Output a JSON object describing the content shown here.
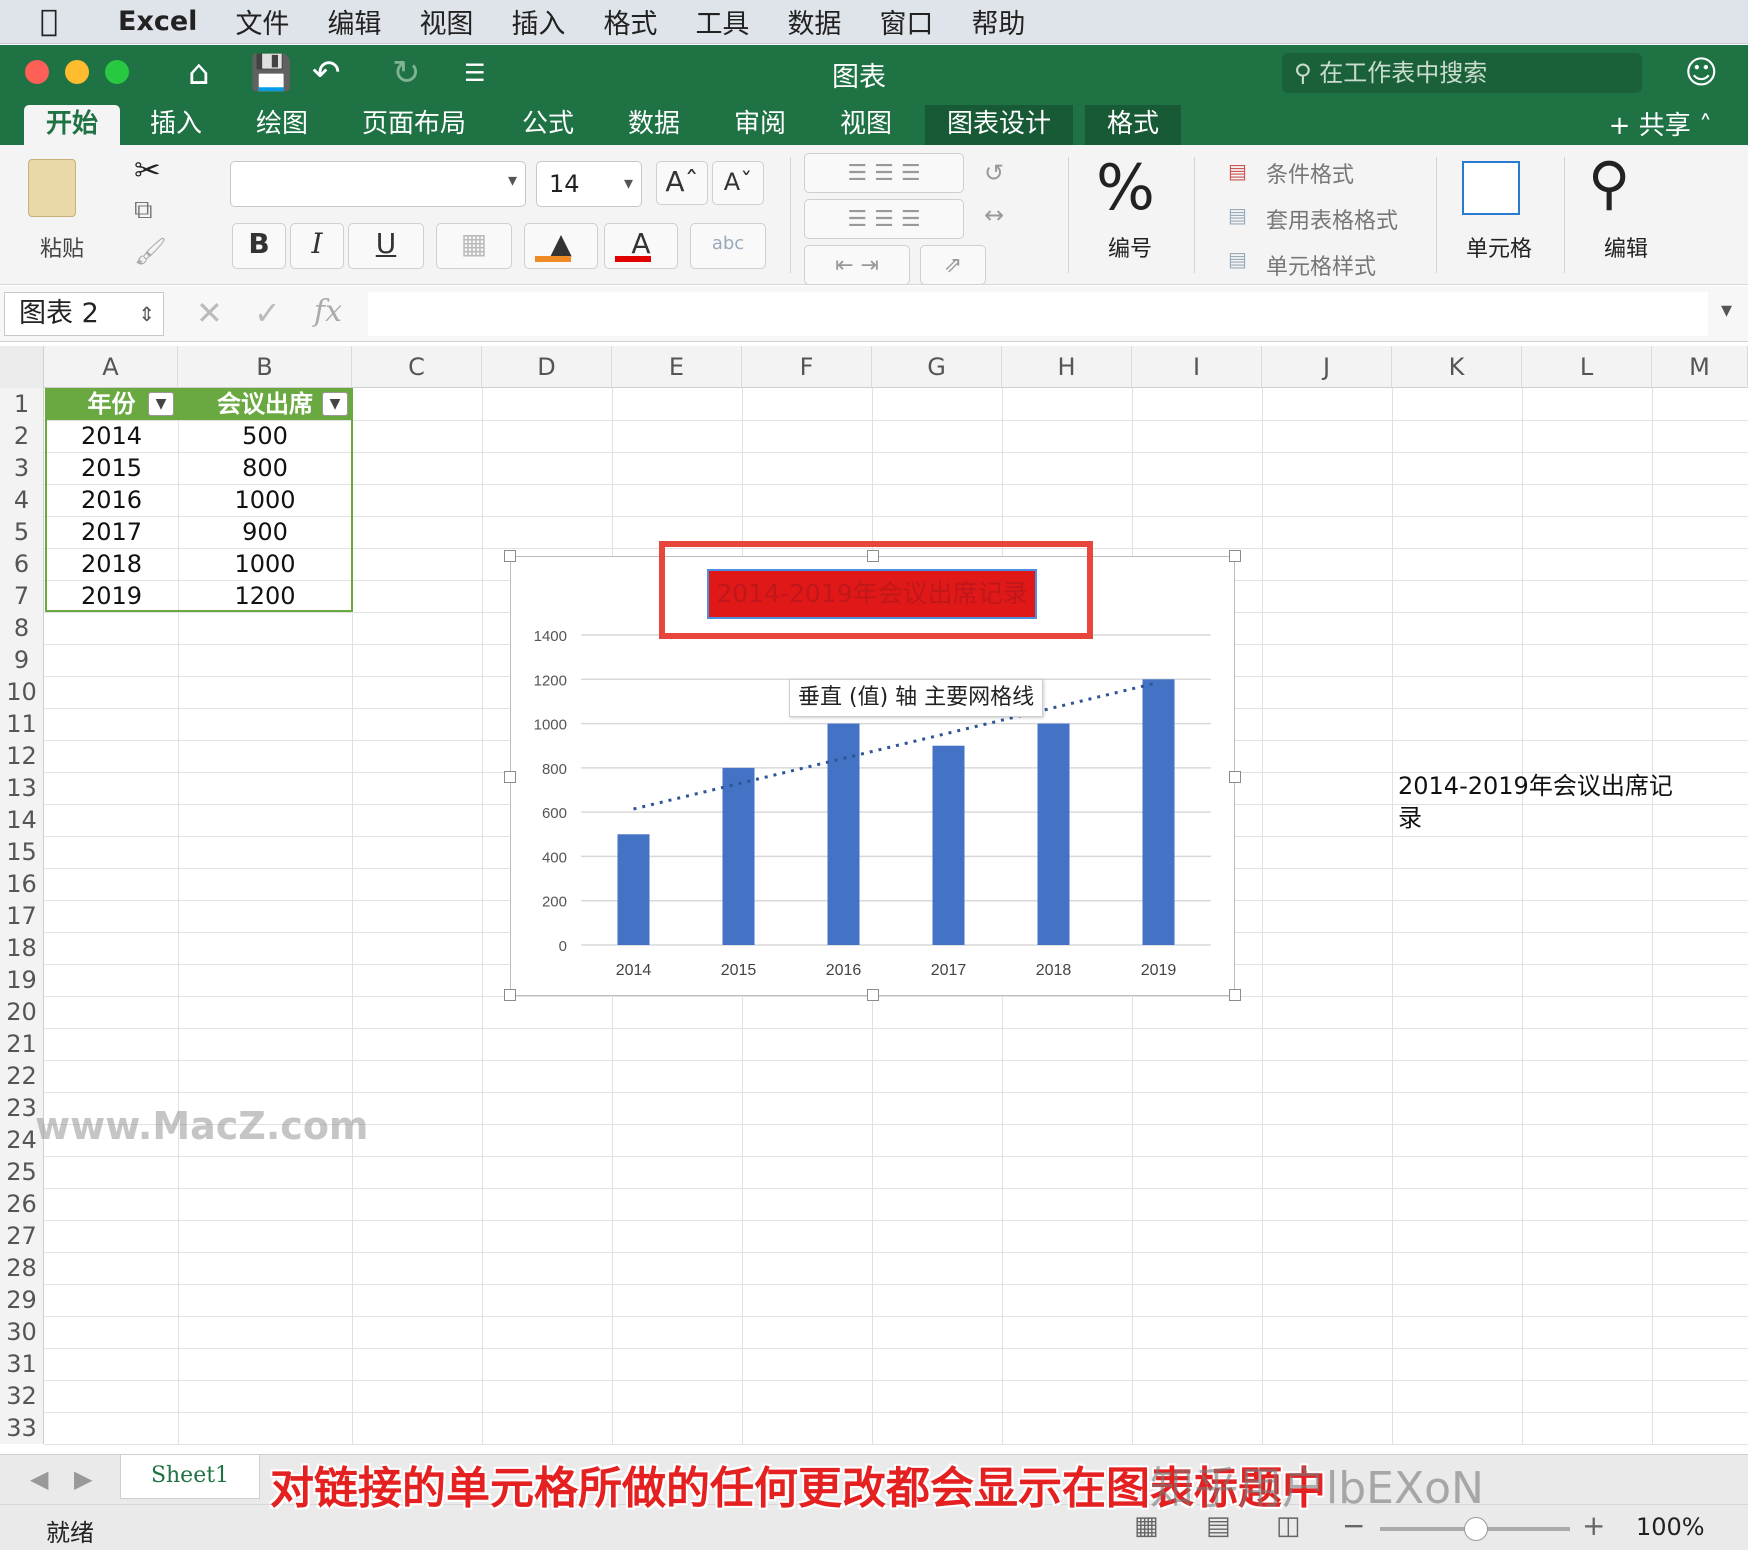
{
  "menubar": {
    "app": "Excel",
    "items": [
      "文件",
      "编辑",
      "视图",
      "插入",
      "格式",
      "工具",
      "数据",
      "窗口",
      "帮助"
    ]
  },
  "titlebar": {
    "title": "图表",
    "search_placeholder": "在工作表中搜索"
  },
  "tabs": [
    "开始",
    "插入",
    "绘图",
    "页面布局",
    "公式",
    "数据",
    "审阅",
    "视图",
    "图表设计",
    "格式"
  ],
  "share": "共享",
  "ribbon": {
    "paste": "粘贴",
    "font_size": "14",
    "number": "编号",
    "conditional_format": "条件格式",
    "table_format": "套用表格格式",
    "cell_styles": "单元格样式",
    "cells": "单元格",
    "edit": "编辑"
  },
  "formula_bar": {
    "name_box": "图表 2",
    "fx": "fx"
  },
  "columns": [
    "A",
    "B",
    "C",
    "D",
    "E",
    "F",
    "G",
    "H",
    "I",
    "J",
    "K",
    "L",
    "M"
  ],
  "rows": [
    "1",
    "2",
    "3",
    "4",
    "5",
    "6",
    "7",
    "8",
    "9",
    "10",
    "11",
    "12",
    "13",
    "14",
    "15",
    "16",
    "17",
    "18",
    "19",
    "20",
    "21",
    "22",
    "23",
    "24",
    "25",
    "26",
    "27",
    "28",
    "29",
    "30",
    "31",
    "32",
    "33"
  ],
  "table": {
    "headers": [
      "年份",
      "会议出席"
    ],
    "rows": [
      [
        "2014",
        "500"
      ],
      [
        "2015",
        "800"
      ],
      [
        "2016",
        "1000"
      ],
      [
        "2017",
        "900"
      ],
      [
        "2018",
        "1000"
      ],
      [
        "2019",
        "1200"
      ]
    ]
  },
  "linked_cell_text": "2014-2019年会议出席记录",
  "chart_data": {
    "type": "bar",
    "title": "2014-2019年会议出席记录",
    "categories": [
      "2014",
      "2015",
      "2016",
      "2017",
      "2018",
      "2019"
    ],
    "values": [
      500,
      800,
      1000,
      900,
      1000,
      1200
    ],
    "ylim": [
      0,
      1400
    ],
    "yticks": [
      "0",
      "200",
      "400",
      "600",
      "800",
      "1000",
      "1200",
      "1400"
    ],
    "trendline": "linear",
    "grid": true,
    "bar_color": "#4472c4",
    "title_fill": "#e01818"
  },
  "tooltip": "垂直 (值) 轴 主要网格线",
  "sheet_tab": "Sheet1",
  "status": {
    "ready": "就绪",
    "zoom": "100%"
  },
  "watermark": "www.MacZ.com",
  "caption": "对链接的单元格所做的任何更改都会显示在图表标题中",
  "caption_overlay": "知乎用户lbEXoN"
}
